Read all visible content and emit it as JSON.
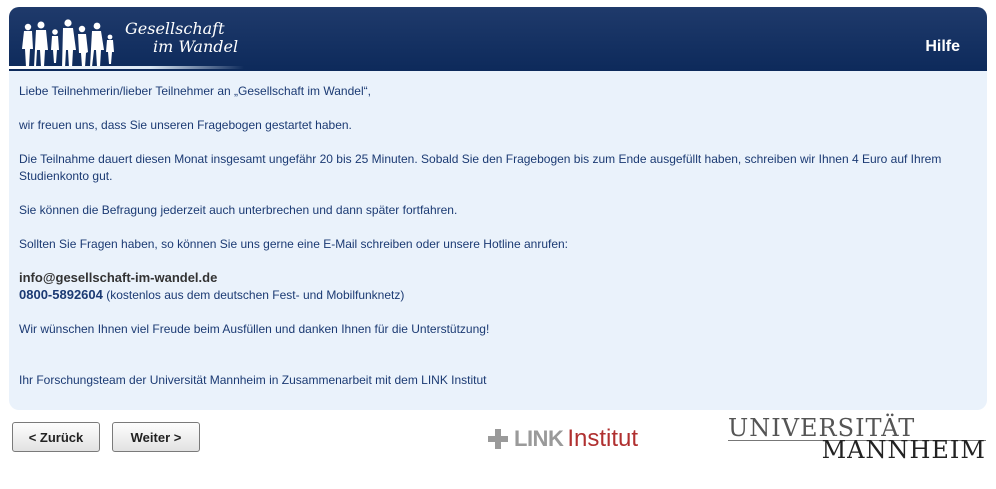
{
  "header": {
    "title_line1": "Gesellschaft",
    "title_line2": "im Wandel",
    "help_label": "Hilfe",
    "logo_icon": "people-silhouettes-icon"
  },
  "content": {
    "greeting": "Liebe Teilnehmerin/lieber Teilnehmer an „Gesellschaft im Wandel“,",
    "intro": "wir freuen uns, dass Sie unseren Fragebogen gestartet haben.",
    "duration": "Die Teilnahme dauert diesen Monat insgesamt ungefähr 20 bis 25 Minuten. Sobald Sie den Fragebogen bis zum Ende ausgefüllt haben, schreiben wir Ihnen 4 Euro auf Ihrem Studienkonto gut.",
    "pause": "Sie können die Befragung jederzeit auch unterbrechen und dann später fortfahren.",
    "questions": "Sollten Sie Fragen haben, so können Sie uns gerne eine E-Mail schreiben oder unsere Hotline anrufen:",
    "email": "info@gesellschaft-im-wandel.de",
    "hotline_number": "0800-5892604",
    "hotline_note": " (kostenlos aus dem deutschen Fest- und Mobilfunknetz)",
    "thanks": "Wir wünschen Ihnen viel Freude beim Ausfüllen und danken Ihnen für die Unterstützung!",
    "signature": "Ihr Forschungsteam der Universität Mannheim in Zusammenarbeit mit dem LINK Institut"
  },
  "buttons": {
    "back_label": "< Zurück",
    "next_label": "Weiter >"
  },
  "logos": {
    "link_word": "LINK",
    "institut_word": "Institut",
    "uni_top": "UNIVERSITÄT",
    "uni_bottom": "MANNHEIM"
  },
  "colors": {
    "header_bg": "#0d2a5b",
    "content_bg": "#eaf2fb",
    "text": "#1b3a73",
    "link_red": "#b03030"
  }
}
